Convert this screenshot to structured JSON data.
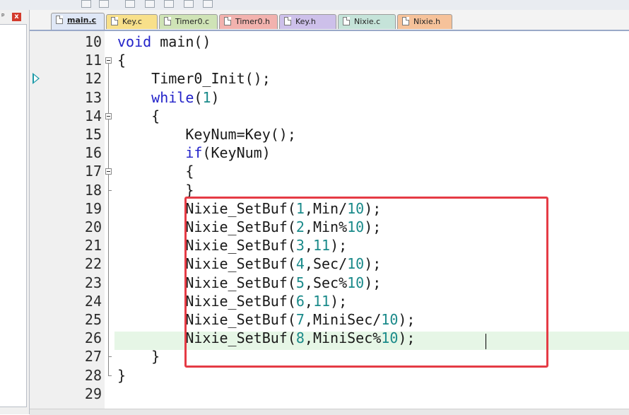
{
  "panel": {
    "pin_glyph": "ᵖ",
    "close_glyph": "x"
  },
  "tabs": [
    {
      "label": "main.c",
      "color": "#dfe7f6",
      "active": true
    },
    {
      "label": "Key.c",
      "color": "#f8e08a"
    },
    {
      "label": "Timer0.c",
      "color": "#cfe3b6"
    },
    {
      "label": "Timer0.h",
      "color": "#f2b2ae"
    },
    {
      "label": "Key.h",
      "color": "#cdc0ea"
    },
    {
      "label": "Nixie.c",
      "color": "#c5e3d9"
    },
    {
      "label": "Nixie.h",
      "color": "#f6c29a"
    }
  ],
  "editor": {
    "current_line": "26",
    "lines": [
      {
        "n": "10",
        "tokens": [
          {
            "t": "void",
            "k": "kw"
          },
          {
            "t": " main()"
          }
        ]
      },
      {
        "n": "11",
        "tokens": [
          {
            "t": "{"
          }
        ]
      },
      {
        "n": "12",
        "tokens": [
          {
            "t": "    Timer0_Init();"
          }
        ]
      },
      {
        "n": "13",
        "tokens": [
          {
            "t": "    "
          },
          {
            "t": "while",
            "k": "kw"
          },
          {
            "t": "("
          },
          {
            "t": "1",
            "k": "num"
          },
          {
            "t": ")"
          }
        ]
      },
      {
        "n": "14",
        "tokens": [
          {
            "t": "    {"
          }
        ]
      },
      {
        "n": "15",
        "tokens": [
          {
            "t": "        KeyNum=Key();"
          }
        ]
      },
      {
        "n": "16",
        "tokens": [
          {
            "t": "        "
          },
          {
            "t": "if",
            "k": "kw"
          },
          {
            "t": "(KeyNum)"
          }
        ]
      },
      {
        "n": "17",
        "tokens": [
          {
            "t": "        {"
          }
        ]
      },
      {
        "n": "18",
        "tokens": [
          {
            "t": "        }"
          }
        ]
      },
      {
        "n": "19",
        "tokens": [
          {
            "t": "        Nixie_SetBuf("
          },
          {
            "t": "1",
            "k": "num"
          },
          {
            "t": ",Min/"
          },
          {
            "t": "10",
            "k": "num"
          },
          {
            "t": ");"
          }
        ]
      },
      {
        "n": "20",
        "tokens": [
          {
            "t": "        Nixie_SetBuf("
          },
          {
            "t": "2",
            "k": "num"
          },
          {
            "t": ",Min%"
          },
          {
            "t": "10",
            "k": "num"
          },
          {
            "t": ");"
          }
        ]
      },
      {
        "n": "21",
        "tokens": [
          {
            "t": "        Nixie_SetBuf("
          },
          {
            "t": "3",
            "k": "num"
          },
          {
            "t": ","
          },
          {
            "t": "11",
            "k": "num"
          },
          {
            "t": ");"
          }
        ]
      },
      {
        "n": "22",
        "tokens": [
          {
            "t": "        Nixie_SetBuf("
          },
          {
            "t": "4",
            "k": "num"
          },
          {
            "t": ",Sec/"
          },
          {
            "t": "10",
            "k": "num"
          },
          {
            "t": ");"
          }
        ]
      },
      {
        "n": "23",
        "tokens": [
          {
            "t": "        Nixie_SetBuf("
          },
          {
            "t": "5",
            "k": "num"
          },
          {
            "t": ",Sec%"
          },
          {
            "t": "10",
            "k": "num"
          },
          {
            "t": ");"
          }
        ]
      },
      {
        "n": "24",
        "tokens": [
          {
            "t": "        Nixie_SetBuf("
          },
          {
            "t": "6",
            "k": "num"
          },
          {
            "t": ","
          },
          {
            "t": "11",
            "k": "num"
          },
          {
            "t": ");"
          }
        ]
      },
      {
        "n": "25",
        "tokens": [
          {
            "t": "        Nixie_SetBuf("
          },
          {
            "t": "7",
            "k": "num"
          },
          {
            "t": ",MiniSec/"
          },
          {
            "t": "10",
            "k": "num"
          },
          {
            "t": ");"
          }
        ]
      },
      {
        "n": "26",
        "tokens": [
          {
            "t": "        Nixie_SetBuf("
          },
          {
            "t": "8",
            "k": "num"
          },
          {
            "t": ",MiniSec%"
          },
          {
            "t": "10",
            "k": "num"
          },
          {
            "t": ");"
          }
        ]
      },
      {
        "n": "27",
        "tokens": [
          {
            "t": "    }"
          }
        ]
      },
      {
        "n": "28",
        "tokens": [
          {
            "t": "}"
          }
        ]
      },
      {
        "n": "29",
        "tokens": [
          {
            "t": ""
          }
        ]
      }
    ]
  },
  "icons": {
    "breakpoint_marker": "execution-arrow-icon",
    "fold": "fold-collapse-icon"
  },
  "colors": {
    "keyword": "#2323c9",
    "number": "#1a8a8a",
    "highlight_box": "#e53b45",
    "current_line": "#e6f6e6"
  }
}
